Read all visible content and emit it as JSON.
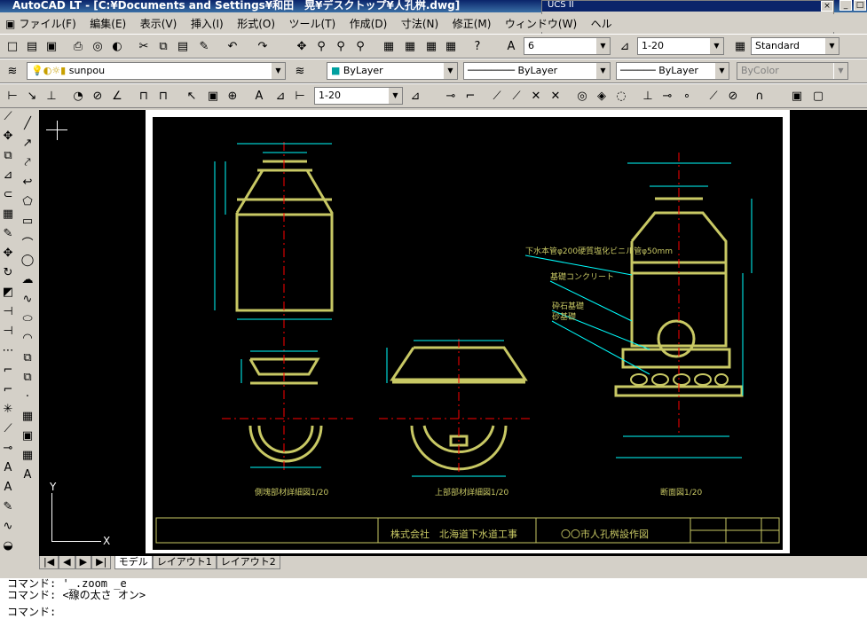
{
  "window": {
    "title": "AutoCAD LT - [C:¥Documents and Settings¥和田　晃¥デスクトップ¥人孔桝.dwg]"
  },
  "menu": {
    "items": [
      "ファイル(F)",
      "編集(E)",
      "表示(V)",
      "挿入(I)",
      "形式(O)",
      "ツール(T)",
      "作成(D)",
      "寸法(N)",
      "修正(M)",
      "ウィンドウ(W)",
      "ヘル"
    ]
  },
  "ucs_toolbar": {
    "title": "UCS II"
  },
  "toolbar": {
    "text_height": "6",
    "scale": "1-20",
    "text_style": "Standard",
    "layer": "sunpou",
    "color": "ByLayer",
    "linetype": "ByLayer",
    "lineweight": "ByLayer",
    "plotstyle": "ByColor",
    "dim_scale": "1-20"
  },
  "ucs_icon": {
    "x_label": "X",
    "y_label": "Y"
  },
  "drawing": {
    "company": "株式会社　北海道下水道工事",
    "project": "〇〇市人孔桝設作図",
    "label_left": "側塊部材詳細図1/20",
    "label_mid": "上部部材詳細図1/20",
    "label_right": "断面図1/20",
    "note1": "下水本管φ200硬質塩化ビニル管φ50mm",
    "note2": "基礎コンクリート",
    "note3": "砕石基礎",
    "note4": "砂基礎"
  },
  "tabs": {
    "model": "モデル",
    "layout1": "レイアウト1",
    "layout2": "レイアウト2"
  },
  "command": {
    "line1": "コマンド: '_.zoom _e",
    "line2": "コマンド: <線の太さ オン>",
    "line3": "コマンド:"
  },
  "colors": {
    "drawing": "#c8c864",
    "dim": "#00ffff",
    "center": "#ff0000",
    "canvas": "#000000"
  }
}
